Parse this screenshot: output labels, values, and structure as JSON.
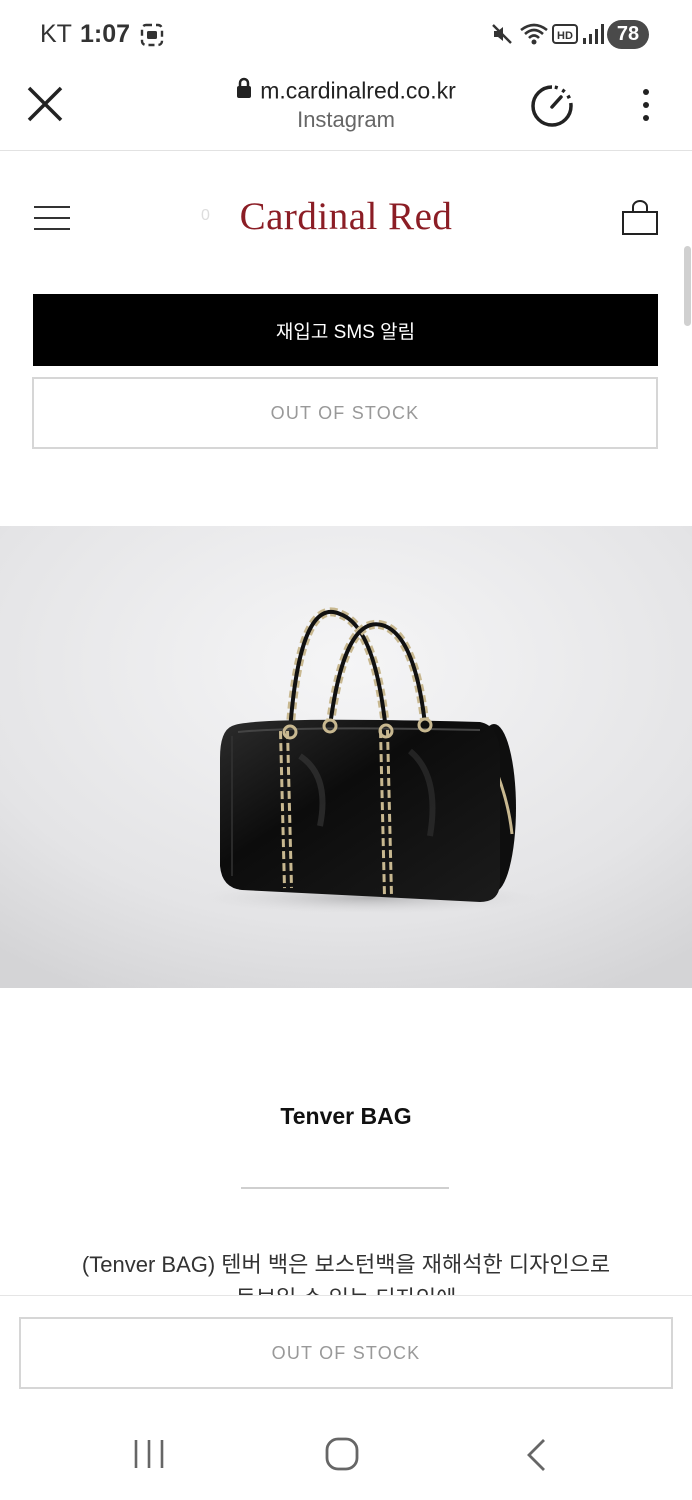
{
  "status_bar": {
    "carrier": "KT",
    "time": "1:07",
    "battery": "78"
  },
  "browser": {
    "url": "m.cardinalred.co.kr",
    "source": "Instagram"
  },
  "site": {
    "logo": "Cardinal Red",
    "cart_count": "0"
  },
  "actions": {
    "restock_sms": "재입고 SMS 알림",
    "out_of_stock": "OUT OF STOCK"
  },
  "product": {
    "name": "Tenver BAG",
    "description_line1": "(Tenver BAG) 텐버 백은 보스턴백을 재해석한 디자인으로",
    "description_line2": "돋보일 수 있는 디자인에"
  },
  "bottom_bar": {
    "button_label": "OUT OF STOCK"
  },
  "colors": {
    "brand": "#8b1d25",
    "black_button": "#000000"
  }
}
